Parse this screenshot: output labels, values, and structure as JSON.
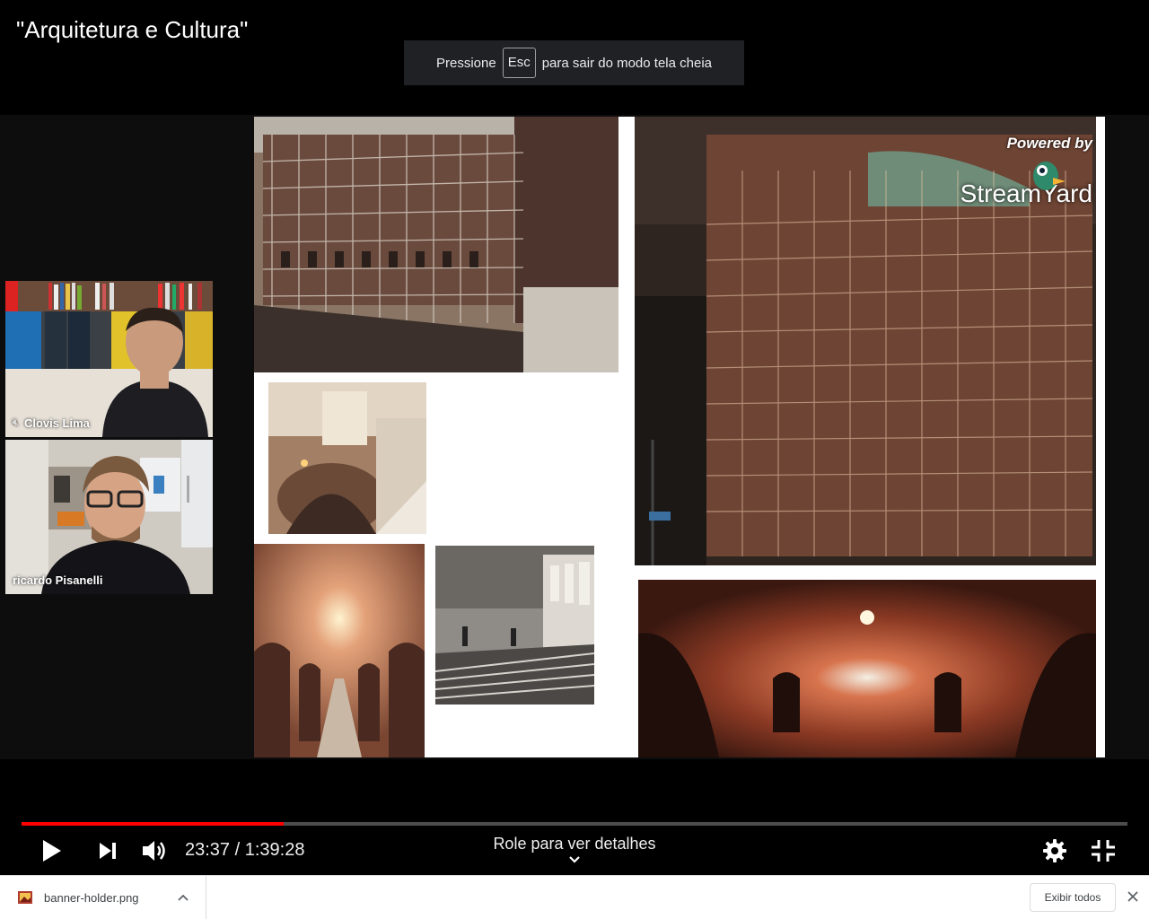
{
  "video": {
    "title": "\"Arquitetura e Cultura\""
  },
  "fullscreen_toast": {
    "before": "Pressione",
    "key": "Esc",
    "after": "para sair do modo tela cheia"
  },
  "participants": [
    {
      "name": "Clovis Lima",
      "muted": true
    },
    {
      "name": "ricardo Pisanelli",
      "muted": false
    }
  ],
  "overlay": {
    "powered_by": "Powered by",
    "brand": "StreamYard"
  },
  "player": {
    "current_time": "23:37",
    "separator": "/",
    "duration": "1:39:28",
    "progress_fraction": 0.2373,
    "scroll_hint": "Role para ver detalhes",
    "accent_color": "#ff0000"
  },
  "downloads": {
    "file_name": "banner-holder.png",
    "show_all": "Exibir todos"
  },
  "icons": [
    "play-icon",
    "next-icon",
    "volume-icon",
    "settings-gear-icon",
    "exit-fullscreen-icon",
    "chevron-down-icon",
    "chevron-up-icon",
    "close-icon",
    "image-file-icon",
    "mic-muted-icon"
  ]
}
